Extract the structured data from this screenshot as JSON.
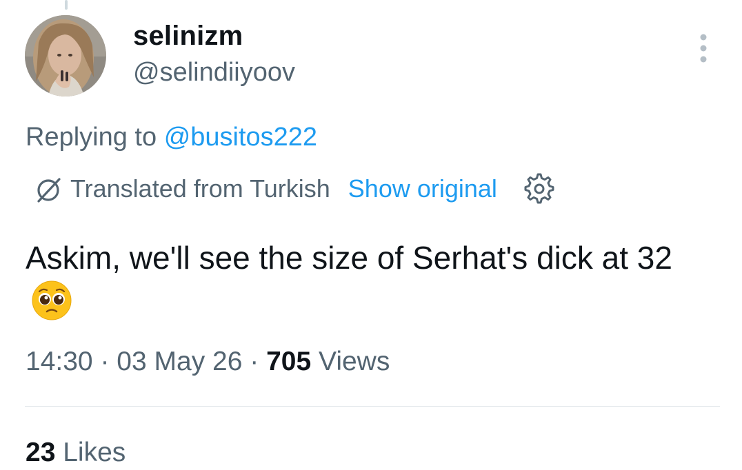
{
  "author": {
    "display_name": "selinizm",
    "handle": "@selindiiyoov"
  },
  "reply": {
    "prefix": "Replying to",
    "mention": "@busitos222"
  },
  "translation": {
    "label": "Translated from Turkish",
    "show_original": "Show original",
    "icon": "translate-globe-icon"
  },
  "tweet": {
    "text_line": "Askim, we'll see the size of Serhat's dick at 32",
    "emoji": "pleading-face-emoji"
  },
  "meta": {
    "time": "14:30",
    "separator": "·",
    "date": "03 May 26",
    "views_count": "705",
    "views_label": "Views"
  },
  "engagement": {
    "likes_count": "23",
    "likes_label": "Likes"
  },
  "colors": {
    "accent": "#1d9bf0",
    "secondary_text": "#536471",
    "primary_text": "#0f1419",
    "divider": "#dfe4e8"
  }
}
